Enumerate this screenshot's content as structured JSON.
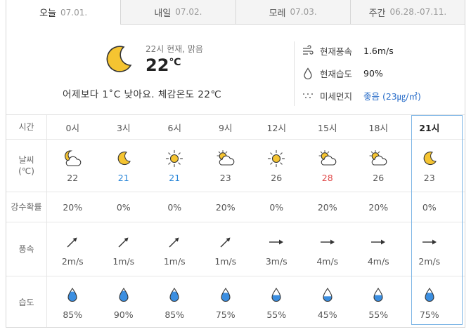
{
  "tabs": [
    {
      "label": "오늘",
      "date": "07.01."
    },
    {
      "label": "내일",
      "date": "07.02."
    },
    {
      "label": "모레",
      "date": "07.03."
    },
    {
      "label": "주간",
      "date": "06.28.-07.11."
    }
  ],
  "current": {
    "condition": "22시 현재, 맑음",
    "temp": "22",
    "unit": "℃",
    "compare": "어제보다 1˚C 낮아요.   체감온도 22℃",
    "wind_label": "현재풍속",
    "wind_value": "1.6m/s",
    "humidity_label": "현재습도",
    "humidity_value": "90%",
    "dust_label": "미세먼지",
    "dust_value": "좋음 (23㎍/㎥)"
  },
  "row_labels": {
    "time": "시간",
    "weather_line1": "날씨",
    "weather_line2": "(℃)",
    "rain": "강수확률",
    "wind": "풍속",
    "humidity": "습도"
  },
  "hours": [
    {
      "time": "0시",
      "icon": "partly-cloudy-night-icon",
      "temp": "22",
      "rain": "20%",
      "wind": "2m/s",
      "dir": "ne",
      "humidity": "85%",
      "hum": 0.85
    },
    {
      "time": "3시",
      "icon": "moon-icon",
      "temp": "21",
      "rain": "0%",
      "wind": "1m/s",
      "dir": "ne",
      "humidity": "90%",
      "hum": 0.9
    },
    {
      "time": "6시",
      "icon": "sun-icon",
      "temp": "21",
      "rain": "0%",
      "wind": "1m/s",
      "dir": "ne",
      "humidity": "85%",
      "hum": 0.85
    },
    {
      "time": "9시",
      "icon": "partly-cloudy-icon",
      "temp": "23",
      "rain": "20%",
      "wind": "1m/s",
      "dir": "ne",
      "humidity": "75%",
      "hum": 0.75
    },
    {
      "time": "12시",
      "icon": "sun-icon",
      "temp": "26",
      "rain": "0%",
      "wind": "3m/s",
      "dir": "e",
      "humidity": "55%",
      "hum": 0.55
    },
    {
      "time": "15시",
      "icon": "partly-cloudy-icon",
      "temp": "28",
      "rain": "20%",
      "wind": "4m/s",
      "dir": "e",
      "humidity": "45%",
      "hum": 0.45
    },
    {
      "time": "18시",
      "icon": "partly-cloudy-icon",
      "temp": "26",
      "rain": "20%",
      "wind": "4m/s",
      "dir": "e",
      "humidity": "55%",
      "hum": 0.55
    },
    {
      "time": "21시",
      "icon": "moon-icon",
      "temp": "23",
      "rain": "0%",
      "wind": "2m/s",
      "dir": "e",
      "humidity": "75%",
      "hum": 0.75
    }
  ],
  "colors": {
    "min_temp": "#2a86d8",
    "max_temp": "#e04a4a",
    "accent": "#7eb6e6"
  }
}
